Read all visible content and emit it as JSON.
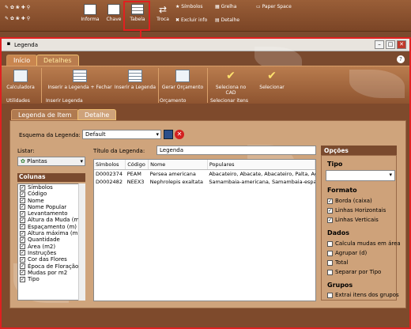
{
  "toolbar": {
    "informa": "Informa",
    "chave": "Chave",
    "tabela": "Tabela",
    "troca": "Troca",
    "simbolos": "Símbolos",
    "grelha": "Grelha",
    "paper_space": "Paper Space",
    "excluir_info": "Excluir info",
    "detalhe": "Detalhe"
  },
  "window": {
    "title": "Legenda",
    "help": "?"
  },
  "tabs": {
    "inicio": "Início",
    "detalhes": "Detalhes"
  },
  "ribbon": {
    "calculadora": "Calculadora",
    "inserir_fechar": "Inserir a Legenda + Fechar",
    "inserir": "Inserir a Legenda",
    "gerar": "Gerar Orçamento",
    "seleciona_cad": "Seleciona no CAD",
    "selecionar": "Selecionar",
    "grp_utilidades": "Utilidades",
    "grp_inserir": "Inserir Legenda",
    "grp_orcamento": "Orçamento",
    "grp_selecionar": "Selecionar itens"
  },
  "inner_tabs": {
    "legenda_item": "Legenda de Item",
    "detalhe": "Detalhe"
  },
  "esquema": {
    "label": "Esquema da Legenda:",
    "value": "Default"
  },
  "listar": {
    "label": "Listar:",
    "value": "Plantas"
  },
  "colunas": {
    "label": "Colunas",
    "items": [
      "Símbolos",
      "Código",
      "Nome",
      "Nome Popular",
      "Levantamento",
      "Altura da Muda (m",
      "Espaçamento (m)",
      "Altura máxima (m",
      "Quantidade",
      "Área (m2)",
      "Instruções",
      "Cor das Flores",
      "Época de Floração",
      "Mudas por m2",
      "Tipo"
    ]
  },
  "titulo": {
    "label": "Título da Legenda:",
    "value": "Legenda"
  },
  "grid": {
    "headers": [
      "Símbolos",
      "Código",
      "Nome",
      "Populares"
    ],
    "rows": [
      [
        "D0002374",
        "PEAM",
        "Persea americana",
        "Abacateiro, Abacate, Abacateiro, Palta, Ag"
      ],
      [
        "D0002482",
        "NEEX3",
        "Nephrolepis exaltata",
        "Samambaia-americana, Samambaia-espa"
      ]
    ]
  },
  "opcoes": {
    "title": "Opções",
    "tipo": "Tipo",
    "formato": "Formato",
    "borda": "Borda (caixa)",
    "linhas_h": "Linhas Horizontais",
    "linhas_v": "Linhas Verticais",
    "dados": "Dados",
    "calcula": "Calcula mudas em área",
    "agrupar": "Agrupar (d)",
    "total": "Total",
    "separar": "Separar por Tipo",
    "grupos": "Grupos",
    "extrai": "Extrai itens dos grupos"
  },
  "colors": {
    "accent": "#e02020",
    "brown": "#7a4a2e"
  }
}
